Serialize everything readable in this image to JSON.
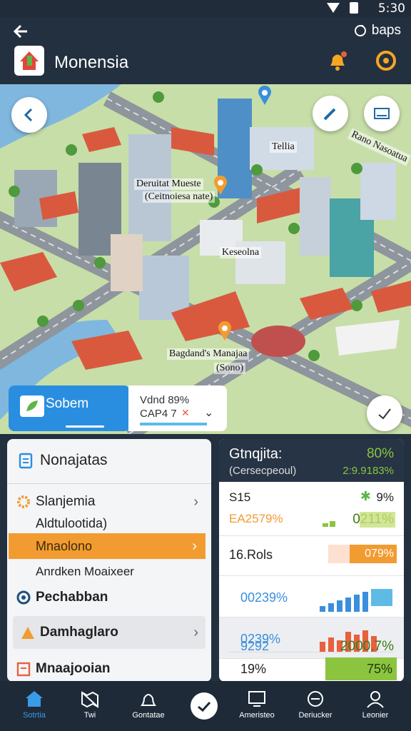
{
  "status": {
    "text": "5:30"
  },
  "header": {
    "back_label": "",
    "right_label": "baps",
    "app_title": "Monensia"
  },
  "map": {
    "labels": {
      "a": "Tellia",
      "b": "Deruitat Mueste",
      "c": "(Ceitnoiesa nate)",
      "d": "Keseolna",
      "e": "Bagdand's Manajaa",
      "f": "(Sono)",
      "g": "Rano Nasoatua"
    }
  },
  "location_card": {
    "title": "Sobem",
    "info_line1": "Vdnd 89%",
    "info_line2": "CAP4 7"
  },
  "left_panel": {
    "title": "Nonajatas",
    "items": [
      {
        "label": "Slanjemia",
        "chevron": true
      },
      {
        "label": "Aldtulootida)"
      },
      {
        "label": "Mnaolono",
        "chevron": true,
        "highlight": true
      },
      {
        "label": "Anrdken Moaixeer"
      },
      {
        "label": "Pechabban"
      },
      {
        "label": "Damhaglaro",
        "chevron": true
      },
      {
        "label": "Mnaajooian"
      }
    ]
  },
  "right_panel": {
    "title": "Gtnqjita:",
    "title_value": "80%",
    "subtitle": "(Cersecpeoul)",
    "subtitle_value": "2:9.9183%",
    "rows": [
      {
        "left": "S15",
        "right": "9%",
        "sub_left": "EA2579%",
        "sub_right": "0211%"
      },
      {
        "left": "16.Rols",
        "right": "079%"
      },
      {
        "left": "00239%",
        "right": ""
      },
      {
        "left": "0239%",
        "right": ""
      },
      {
        "left": "9292",
        "right": "2000,7%"
      },
      {
        "left": "19%",
        "right": "75%"
      }
    ],
    "colors": {
      "green": "#8bc53f",
      "orange": "#f29b30",
      "blue": "#3a8fdc",
      "red": "#e8603c"
    }
  },
  "nav": {
    "items": [
      {
        "label": "Sotrtia",
        "active": true
      },
      {
        "label": "Twi"
      },
      {
        "label": "Gontatae"
      },
      {
        "label": ""
      },
      {
        "label": "Ameristeo"
      },
      {
        "label": "Deriucker"
      },
      {
        "label": "Leonier"
      }
    ]
  }
}
